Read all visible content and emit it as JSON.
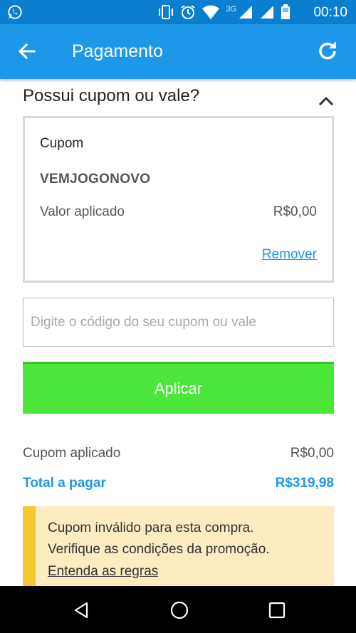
{
  "status_bar": {
    "network": "3G",
    "time": "00:10",
    "icons": [
      "whatsapp-icon",
      "vibrate-icon",
      "alarm-icon",
      "wifi-icon",
      "signal-icon",
      "signal-icon",
      "battery-icon"
    ]
  },
  "app_bar": {
    "title": "Pagamento",
    "back_icon": "arrow-left-icon",
    "refresh_icon": "refresh-icon"
  },
  "coupon_section": {
    "title": "Possui cupom ou vale?",
    "toggle_icon": "chevron-up-icon"
  },
  "coupon_card": {
    "label": "Cupom",
    "code": "VEMJOGONOVO",
    "applied_label": "Valor aplicado",
    "applied_value": "R$0,00",
    "remove_label": "Remover"
  },
  "code_input": {
    "value": "",
    "placeholder": "Digite o código do seu cupom ou vale"
  },
  "apply_button": {
    "label": "Aplicar"
  },
  "summary": {
    "coupon_label": "Cupom aplicado",
    "coupon_value": "R$0,00",
    "total_label": "Total a pagar",
    "total_value": "R$319,98"
  },
  "alert": {
    "line1": "Cupom inválido para esta compra.",
    "line2": "Verifique as condições da promoção.",
    "link_label": "Entenda as regras"
  },
  "nav_bar": {
    "icons": [
      "back-triangle-icon",
      "home-circle-icon",
      "recents-square-icon"
    ]
  },
  "colors": {
    "status_bar": "#0a7fcf",
    "app_bar": "#1d98e8",
    "accent": "#1d98e8",
    "apply_button": "#4ce63a",
    "alert_bg": "#fbedc0",
    "alert_border": "#f3c830"
  }
}
